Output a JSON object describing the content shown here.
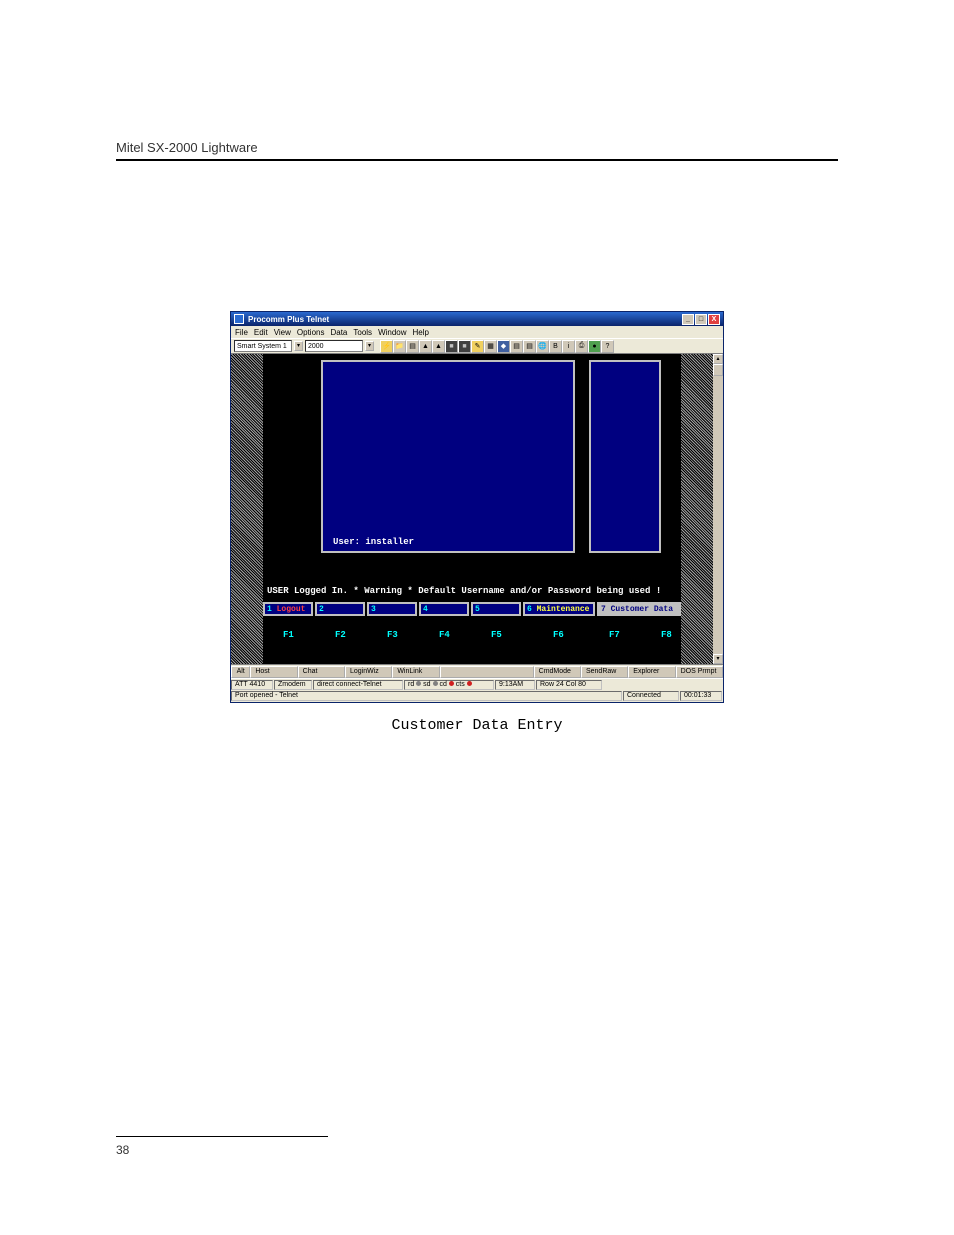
{
  "page": {
    "header": "Mitel SX-2000 Lightware",
    "caption": "Customer Data Entry",
    "number": "38"
  },
  "window": {
    "title": "Procomm Plus Telnet",
    "controls": {
      "min": "_",
      "max": "□",
      "close": "X"
    }
  },
  "menubar": [
    "File",
    "Edit",
    "View",
    "Options",
    "Data",
    "Tools",
    "Window",
    "Help"
  ],
  "toolbar": {
    "session": "Smart System 1",
    "port": "2000"
  },
  "terminal": {
    "user_line": "User: installer",
    "warning": "USER Logged In. * Warning * Default Username and/or Password being used !",
    "menu": [
      {
        "n": "1",
        "label": "Logout"
      },
      {
        "n": "2",
        "label": ""
      },
      {
        "n": "3",
        "label": ""
      },
      {
        "n": "4",
        "label": ""
      },
      {
        "n": "5",
        "label": ""
      },
      {
        "n": "6",
        "label": "Maintenance"
      },
      {
        "n": "7",
        "label": "Customer Data"
      }
    ],
    "fkeys": [
      "F1",
      "F2",
      "F3",
      "F4",
      "F5",
      "F6",
      "F7",
      "F8"
    ]
  },
  "bottom_tabs": [
    "Alt",
    "Host",
    "Chat",
    "LoginWiz",
    "WinLink",
    "",
    "CmdMode",
    "SendRaw",
    "Explorer",
    "DOS Prmpt"
  ],
  "status1": {
    "att": "ATT 4410",
    "proto": "Zmodem",
    "conn": "direct connect-Telnet",
    "leds": [
      "rd",
      "sd",
      "cd",
      "cts"
    ],
    "time": "9:13AM",
    "rowcol": "Row 24  Col 80"
  },
  "status2": {
    "port": "Port opened - Telnet",
    "conn": "Connected",
    "elapsed": "00:01:33"
  }
}
